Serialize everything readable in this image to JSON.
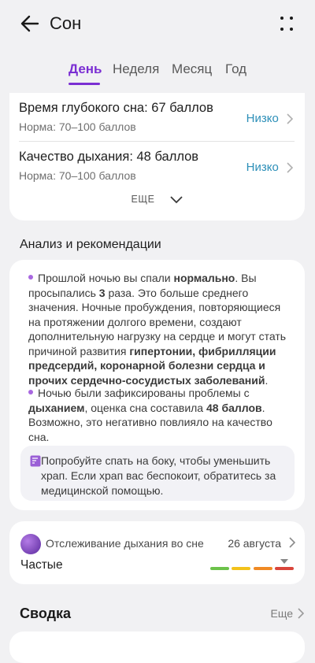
{
  "header": {
    "title": "Сон"
  },
  "tabs": [
    {
      "label": "День",
      "active": true
    },
    {
      "label": "Неделя",
      "active": false
    },
    {
      "label": "Месяц",
      "active": false
    },
    {
      "label": "Год",
      "active": false
    }
  ],
  "metrics": [
    {
      "title": "Время глубокого сна: 67 баллов",
      "norm": "Норма: 70–100 баллов",
      "status": "Низко"
    },
    {
      "title": "Качество дыхания: 48 баллов",
      "norm": "Норма: 70–100 баллов",
      "status": "Низко"
    }
  ],
  "more_toggle": "ЕЩЕ",
  "analysis": {
    "title": "Анализ и рекомендации",
    "p1": {
      "t1": "Прошлой ночью вы спали ",
      "b1": "нормально",
      "t2": ". Вы просыпались ",
      "b2": "3",
      "t3": " раза. Это больше среднего значения. Ночные пробуждения, повторяющиеся на протяжении долгого времени, создают дополнительную нагрузку на сердце и могут стать причиной развития ",
      "b3": "гипертонии, фибрилляции предсердий, коронарной болезни сердца и прочих сердечно-сосудистых заболеваний",
      "t4": "."
    },
    "p2": {
      "t1": "Ночью были зафиксированы проблемы с ",
      "b1": "дыханием",
      "t2": ", оценка сна составила ",
      "b2": "48 баллов",
      "t3": ". Возможно, это негативно повлияло на качество сна."
    },
    "tip": "Попробуйте спать на боку, чтобы уменьшить храп. Если храп вас беспокоит, обратитесь за медицинской помощью."
  },
  "breath_tracking": {
    "label": "Отслеживание дыхания во сне",
    "date": "26 августа",
    "value": "Частые",
    "scale_colors": [
      "#6cc24a",
      "#f3c21b",
      "#f08a24",
      "#d9453b"
    ],
    "marker_segment": 4
  },
  "summary": {
    "title": "Сводка",
    "more_label": "Еще"
  },
  "colors": {
    "accent": "#7b2fd3",
    "status_low": "#2c8fb8"
  }
}
